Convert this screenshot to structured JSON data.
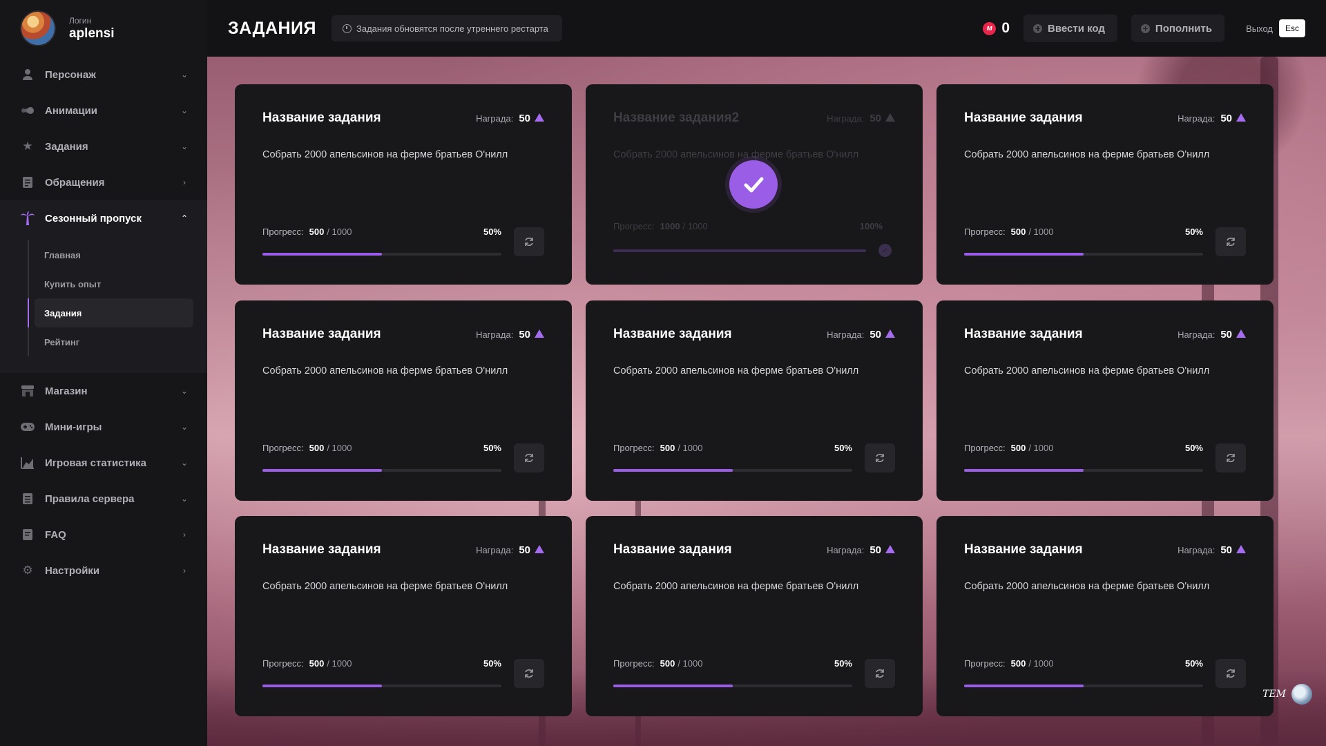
{
  "user": {
    "caption": "Логин",
    "name": "aplensi"
  },
  "sidebar": {
    "items": [
      {
        "label": "Персонаж",
        "icon": "person-icon",
        "arrow": "down"
      },
      {
        "label": "Анимации",
        "icon": "animation-icon",
        "arrow": "down"
      },
      {
        "label": "Задания",
        "icon": "star-icon",
        "arrow": "down"
      },
      {
        "label": "Обращения",
        "icon": "document-icon",
        "arrow": "right"
      },
      {
        "label": "Сезонный пропуск",
        "icon": "palm-icon",
        "arrow": "up",
        "active": true
      },
      {
        "label": "Магазин",
        "icon": "shop-icon",
        "arrow": "down"
      },
      {
        "label": "Мини-игры",
        "icon": "gamepad-icon",
        "arrow": "down"
      },
      {
        "label": "Игровая статистика",
        "icon": "chart-icon",
        "arrow": "down"
      },
      {
        "label": "Правила сервера",
        "icon": "rules-icon",
        "arrow": "down"
      },
      {
        "label": "FAQ",
        "icon": "faq-icon",
        "arrow": "right"
      },
      {
        "label": "Настройки",
        "icon": "gear-icon",
        "arrow": "right"
      }
    ],
    "subitems": [
      {
        "label": "Главная"
      },
      {
        "label": "Купить опыт"
      },
      {
        "label": "Задания",
        "active": true
      },
      {
        "label": "Рейтинг"
      }
    ]
  },
  "header": {
    "title": "ЗАДАНИЯ",
    "notice": "Задания обновятся после утреннего рестарта",
    "currency_value": "0",
    "currency_icon_letter": "м",
    "code_button": "Ввести код",
    "topup_button": "Пополнить",
    "exit_label": "Выход",
    "exit_key": "Esc"
  },
  "colors": {
    "accent": "#9a5de6",
    "currency": "#e8264b"
  },
  "tasks": [
    {
      "title": "Название задания",
      "reward_label": "Награда:",
      "reward": "50",
      "description": "Собрать 2000 апельсинов на ферме братьев О'нилл",
      "progress_label": "Прогресс:",
      "progress": "500",
      "total": "/ 1000",
      "percent": "50%",
      "fill": 0.5,
      "done": false
    },
    {
      "title": "Название задания2",
      "reward_label": "Награда:",
      "reward": "50",
      "description": "Собрать 2000 апельсинов на ферме братьев О'нилл",
      "progress_label": "Прогресс:",
      "progress": "1000",
      "total": "/ 1000",
      "percent": "100%",
      "fill": 1.0,
      "done": true
    },
    {
      "title": "Название задания",
      "reward_label": "Награда:",
      "reward": "50",
      "description": "Собрать 2000 апельсинов на ферме братьев О'нилл",
      "progress_label": "Прогресс:",
      "progress": "500",
      "total": "/ 1000",
      "percent": "50%",
      "fill": 0.5,
      "done": false
    },
    {
      "title": "Название задания",
      "reward_label": "Награда:",
      "reward": "50",
      "description": "Собрать 2000 апельсинов на ферме братьев О'нилл",
      "progress_label": "Прогресс:",
      "progress": "500",
      "total": "/ 1000",
      "percent": "50%",
      "fill": 0.5,
      "done": false
    },
    {
      "title": "Название задания",
      "reward_label": "Награда:",
      "reward": "50",
      "description": "Собрать 2000 апельсинов на ферме братьев О'нилл",
      "progress_label": "Прогресс:",
      "progress": "500",
      "total": "/ 1000",
      "percent": "50%",
      "fill": 0.5,
      "done": false
    },
    {
      "title": "Название задания",
      "reward_label": "Награда:",
      "reward": "50",
      "description": "Собрать 2000 апельсинов на ферме братьев О'нилл",
      "progress_label": "Прогресс:",
      "progress": "500",
      "total": "/ 1000",
      "percent": "50%",
      "fill": 0.5,
      "done": false
    },
    {
      "title": "Название задания",
      "reward_label": "Награда:",
      "reward": "50",
      "description": "Собрать 2000 апельсинов на ферме братьев О'нилл",
      "progress_label": "Прогресс:",
      "progress": "500",
      "total": "/ 1000",
      "percent": "50%",
      "fill": 0.5,
      "done": false
    },
    {
      "title": "Название задания",
      "reward_label": "Награда:",
      "reward": "50",
      "description": "Собрать 2000 апельсинов на ферме братьев О'нилл",
      "progress_label": "Прогресс:",
      "progress": "500",
      "total": "/ 1000",
      "percent": "50%",
      "fill": 0.5,
      "done": false
    },
    {
      "title": "Название задания",
      "reward_label": "Награда:",
      "reward": "50",
      "description": "Собрать 2000 апельсинов на ферме братьев О'нилл",
      "progress_label": "Прогресс:",
      "progress": "500",
      "total": "/ 1000",
      "percent": "50%",
      "fill": 0.5,
      "done": false
    }
  ],
  "watermark": {
    "text": "TEM"
  }
}
